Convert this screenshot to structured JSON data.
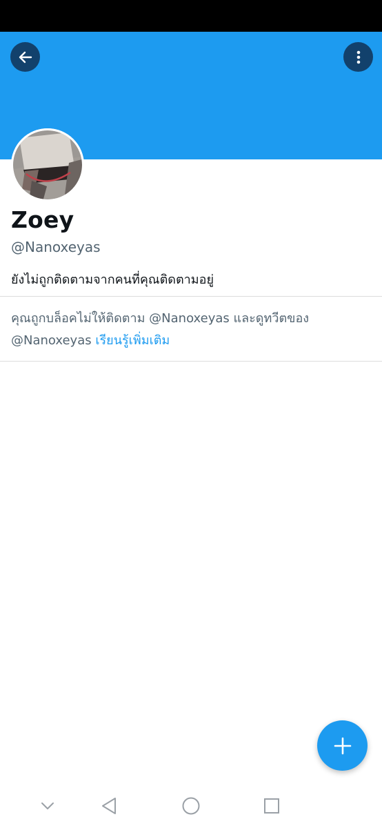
{
  "colors": {
    "banner": "#1d9bf0",
    "accent": "#1d9bf0",
    "text_primary": "#0f1419",
    "text_secondary": "#536471",
    "divider": "#dcdcdc"
  },
  "header": {
    "back_icon": "arrow-left-icon",
    "more_icon": "more-vertical-icon"
  },
  "profile": {
    "display_name": "Zoey",
    "handle": "@Nanoxeyas",
    "follow_status": "ยังไม่ถูกติดตามจากคนที่คุณติดตามอยู่"
  },
  "blocked_notice": {
    "text": "คุณถูกบล็อคไม่ให้ติดตาม @Nanoxeyas และดูทวีตของ @Nanoxeyas",
    "learn_more": "เรียนรู้เพิ่มเติม"
  },
  "fab": {
    "icon": "plus-icon"
  },
  "system_nav": {
    "icons": [
      "chevron-down-icon",
      "triangle-back-icon",
      "circle-home-icon",
      "square-recents-icon"
    ]
  }
}
